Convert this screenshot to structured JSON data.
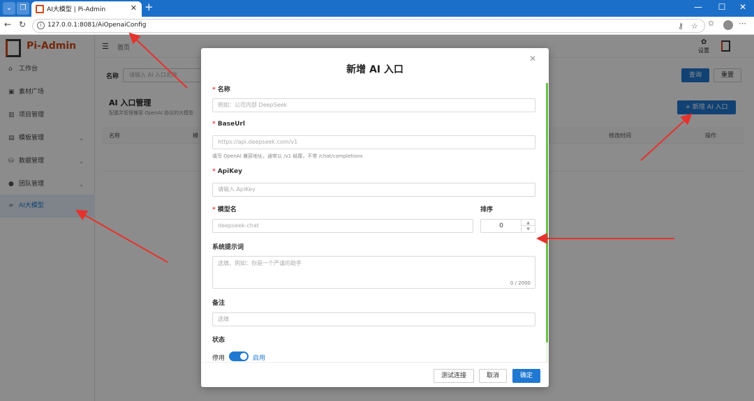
{
  "browser": {
    "tab_title": "AI大模型 | Pi-Admin",
    "url": "127.0.0.1:8081/AiOpenaiConfig"
  },
  "app": {
    "brand": "Pi-Admin",
    "breadcrumb": "首页",
    "settings_label": "设置",
    "sidebar": [
      {
        "label": "工作台",
        "icon": "home-icon",
        "chevron": false
      },
      {
        "label": "素材广场",
        "icon": "grid-icon",
        "chevron": false
      },
      {
        "label": "项目管理",
        "icon": "bar-chart-icon",
        "chevron": false
      },
      {
        "label": "模板管理",
        "icon": "template-icon",
        "chevron": true
      },
      {
        "label": "数据管理",
        "icon": "database-icon",
        "chevron": true
      },
      {
        "label": "团队管理",
        "icon": "user-icon",
        "chevron": true
      },
      {
        "label": "AI大模型",
        "icon": "link-icon",
        "chevron": false,
        "active": true
      }
    ],
    "search": {
      "label": "名称",
      "placeholder": "请输入 AI 入口名称",
      "query_button": "查询",
      "reset_button": "重置"
    },
    "card": {
      "title": "AI 入口管理",
      "desc": "配置并管理兼容 OpenAI 协议的大模型",
      "add_button": "+ 新增 AI 入口"
    },
    "table_headers": {
      "name": "名称",
      "model": "模",
      "modified": "修改时间",
      "actions": "操作"
    }
  },
  "modal": {
    "title": "新增 AI 入口",
    "fields": {
      "name": {
        "label": "名称",
        "placeholder": "例如：公司内部 DeepSeek"
      },
      "base_url": {
        "label": "BaseUrl",
        "placeholder": "https://api.deepseek.com/v1",
        "hint": "填写 OpenAI 兼容地址，通常以 /v1 结尾，不带 /chat/completions"
      },
      "api_key": {
        "label": "ApiKey",
        "placeholder": "请输入 ApiKey"
      },
      "model": {
        "label": "模型名",
        "placeholder": "deepseek-chat"
      },
      "sort": {
        "label": "排序",
        "value": "0"
      },
      "system_prompt": {
        "label": "系统提示词",
        "placeholder": "选填，例如：你是一个严谨的助手",
        "counter": "0 / 2000"
      },
      "remark": {
        "label": "备注",
        "placeholder": "选填"
      },
      "status": {
        "label": "状态",
        "off_label": "停用",
        "on_label": "启用"
      }
    },
    "buttons": {
      "test": "测试连接",
      "cancel": "取消",
      "confirm": "确定"
    }
  },
  "colors": {
    "primary": "#1f78d1",
    "brand": "#d04a1b",
    "annotation": "#e5322d"
  }
}
